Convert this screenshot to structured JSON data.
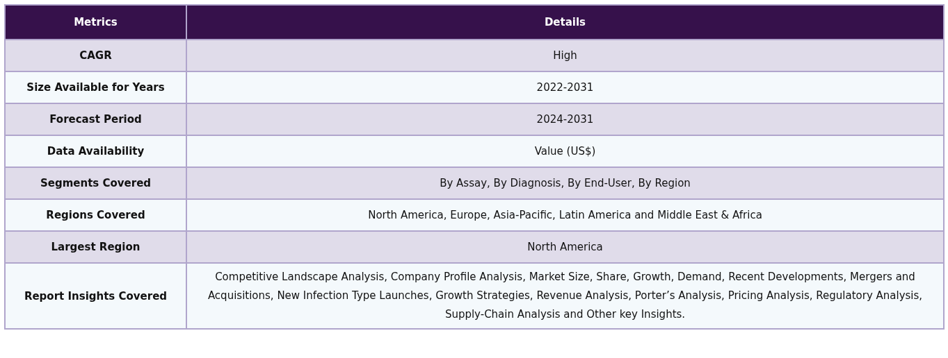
{
  "table": {
    "columns": [
      "Metrics",
      "Details"
    ],
    "rows": [
      {
        "metric": "CAGR",
        "detail": "High"
      },
      {
        "metric": "Size Available for Years",
        "detail": "2022-2031"
      },
      {
        "metric": "Forecast Period",
        "detail": "2024-2031"
      },
      {
        "metric": "Data Availability",
        "detail": "Value (US$)"
      },
      {
        "metric": "Segments Covered",
        "detail": "By Assay, By Diagnosis, By End-User, By Region"
      },
      {
        "metric": "Regions Covered",
        "detail": "North America, Europe, Asia-Pacific, Latin America and Middle East & Africa"
      },
      {
        "metric": "Largest Region",
        "detail": "North America"
      },
      {
        "metric": "Report Insights Covered",
        "detail": "Competitive Landscape Analysis, Company Profile Analysis, Market Size, Share, Growth, Demand, Recent Developments, Mergers and Acquisitions, New Infection Type Launches, Growth Strategies, Revenue Analysis, Porter’s Analysis, Pricing Analysis, Regulatory Analysis, Supply-Chain Analysis and Other key Insights."
      }
    ]
  }
}
